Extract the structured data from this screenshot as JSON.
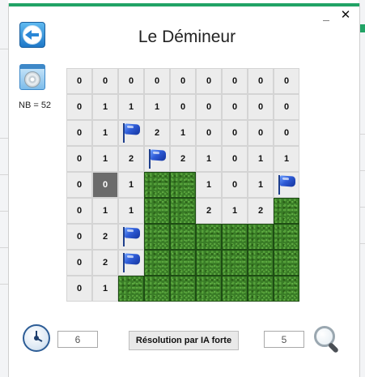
{
  "window": {
    "title": "Le Démineur",
    "minimize_label": "_",
    "close_label": "✕"
  },
  "icons": {
    "back": "back-arrow-icon",
    "disk": "disk-icon",
    "clock": "clock-icon",
    "magnifier": "magnifier-icon",
    "flag": "flag-icon"
  },
  "mine_count_label": "NB = 52",
  "board": {
    "rows": [
      [
        {
          "t": "n",
          "v": "0"
        },
        {
          "t": "n",
          "v": "0"
        },
        {
          "t": "n",
          "v": "0"
        },
        {
          "t": "n",
          "v": "0"
        },
        {
          "t": "n",
          "v": "0"
        },
        {
          "t": "n",
          "v": "0"
        },
        {
          "t": "n",
          "v": "0"
        },
        {
          "t": "n",
          "v": "0"
        },
        {
          "t": "n",
          "v": "0"
        }
      ],
      [
        {
          "t": "n",
          "v": "0"
        },
        {
          "t": "n",
          "v": "1"
        },
        {
          "t": "n",
          "v": "1"
        },
        {
          "t": "n",
          "v": "1"
        },
        {
          "t": "n",
          "v": "0"
        },
        {
          "t": "n",
          "v": "0"
        },
        {
          "t": "n",
          "v": "0"
        },
        {
          "t": "n",
          "v": "0"
        },
        {
          "t": "n",
          "v": "0"
        }
      ],
      [
        {
          "t": "n",
          "v": "0"
        },
        {
          "t": "n",
          "v": "1"
        },
        {
          "t": "flag"
        },
        {
          "t": "n",
          "v": "2"
        },
        {
          "t": "n",
          "v": "1"
        },
        {
          "t": "n",
          "v": "0"
        },
        {
          "t": "n",
          "v": "0"
        },
        {
          "t": "n",
          "v": "0"
        },
        {
          "t": "n",
          "v": "0"
        }
      ],
      [
        {
          "t": "n",
          "v": "0"
        },
        {
          "t": "n",
          "v": "1"
        },
        {
          "t": "n",
          "v": "2"
        },
        {
          "t": "flag"
        },
        {
          "t": "n",
          "v": "2"
        },
        {
          "t": "n",
          "v": "1"
        },
        {
          "t": "n",
          "v": "0"
        },
        {
          "t": "n",
          "v": "1"
        },
        {
          "t": "n",
          "v": "1"
        }
      ],
      [
        {
          "t": "n",
          "v": "0"
        },
        {
          "t": "dark",
          "v": "0"
        },
        {
          "t": "n",
          "v": "1"
        },
        {
          "t": "grass"
        },
        {
          "t": "grass"
        },
        {
          "t": "n",
          "v": "1"
        },
        {
          "t": "n",
          "v": "0"
        },
        {
          "t": "n",
          "v": "1"
        },
        {
          "t": "flag"
        }
      ],
      [
        {
          "t": "n",
          "v": "0"
        },
        {
          "t": "n",
          "v": "1"
        },
        {
          "t": "n",
          "v": "1"
        },
        {
          "t": "grass"
        },
        {
          "t": "grass"
        },
        {
          "t": "n",
          "v": "2"
        },
        {
          "t": "n",
          "v": "1"
        },
        {
          "t": "n",
          "v": "2"
        },
        {
          "t": "grass"
        }
      ],
      [
        {
          "t": "n",
          "v": "0"
        },
        {
          "t": "n",
          "v": "2"
        },
        {
          "t": "flag"
        },
        {
          "t": "grass"
        },
        {
          "t": "grass"
        },
        {
          "t": "grass"
        },
        {
          "t": "grass"
        },
        {
          "t": "grass"
        },
        {
          "t": "grass"
        }
      ],
      [
        {
          "t": "n",
          "v": "0"
        },
        {
          "t": "n",
          "v": "2"
        },
        {
          "t": "flag"
        },
        {
          "t": "grass"
        },
        {
          "t": "grass"
        },
        {
          "t": "grass"
        },
        {
          "t": "grass"
        },
        {
          "t": "grass"
        },
        {
          "t": "grass"
        }
      ],
      [
        {
          "t": "n",
          "v": "0"
        },
        {
          "t": "n",
          "v": "1"
        },
        {
          "t": "grass"
        },
        {
          "t": "grass"
        },
        {
          "t": "grass"
        },
        {
          "t": "grass"
        },
        {
          "t": "grass"
        },
        {
          "t": "grass"
        },
        {
          "t": "grass"
        }
      ]
    ]
  },
  "footer": {
    "time_value": "6",
    "solve_button_label": "Résolution par IA forte",
    "count_value": "5"
  },
  "colors": {
    "accent": "#21a366",
    "grass": "#3a7d27",
    "flag": "#2e5bd6",
    "revealed": "#ececec",
    "dark_cell": "#6b6b6b"
  }
}
